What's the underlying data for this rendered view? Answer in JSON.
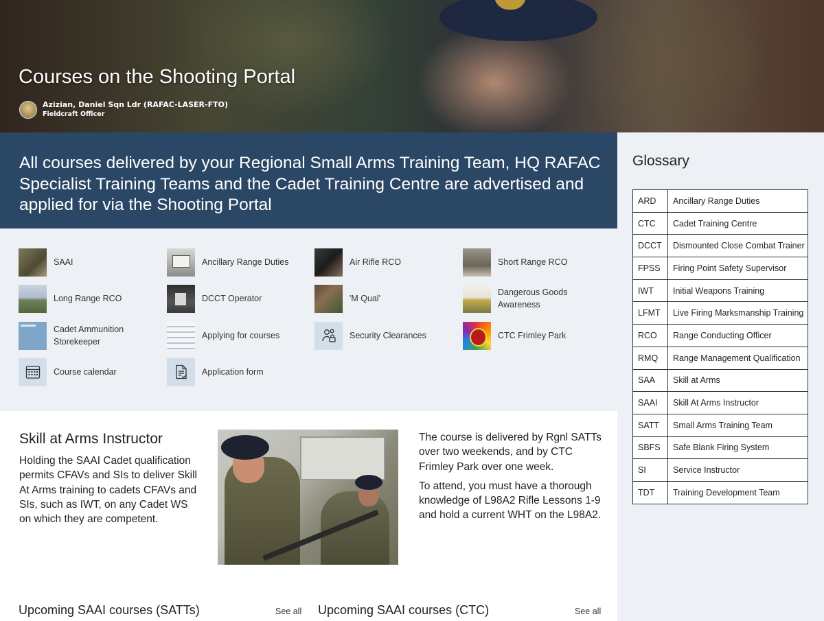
{
  "hero": {
    "title": "Courses on the Shooting Portal",
    "author_name": "Azizian, Daniel Sqn Ldr (RAFAC-LASER-FTO)",
    "author_role": "Fieldcraft Officer"
  },
  "banner": {
    "text": "All courses delivered by your Regional Small Arms Training Team, HQ RAFAC Specialist Training Teams and the Cadet Training Centre are advertised and applied for via the Shooting Portal"
  },
  "quick_links": [
    {
      "label": "SAAI",
      "icon": "saai-thumbnail"
    },
    {
      "label": "Ancillary Range Duties",
      "icon": "ancillary-range-duties-thumbnail"
    },
    {
      "label": "Air Rifle RCO",
      "icon": "air-rifle-rco-thumbnail"
    },
    {
      "label": "Short Range RCO",
      "icon": "short-range-rco-thumbnail"
    },
    {
      "label": "Long Range RCO",
      "icon": "long-range-rco-thumbnail"
    },
    {
      "label": "DCCT Operator",
      "icon": "dcct-operator-thumbnail"
    },
    {
      "label": "'M Qual'",
      "icon": "m-qual-thumbnail"
    },
    {
      "label": "Dangerous Goods Awareness",
      "icon": "dangerous-goods-thumbnail"
    },
    {
      "label": "Cadet Ammunition Storekeeper",
      "icon": "ammunition-storekeeper-thumbnail"
    },
    {
      "label": "Applying for courses",
      "icon": "applying-thumbnail"
    },
    {
      "label": "Security Clearances",
      "icon": "people-lock-icon"
    },
    {
      "label": "CTC Frimley Park",
      "icon": "ctc-crest-thumbnail"
    },
    {
      "label": "Course calendar",
      "icon": "calendar-icon"
    },
    {
      "label": "Application form",
      "icon": "document-check-icon"
    }
  ],
  "glossary": {
    "title": "Glossary",
    "rows": [
      {
        "abbr": "ARD",
        "full": "Ancillary Range Duties"
      },
      {
        "abbr": "CTC",
        "full": "Cadet Training Centre"
      },
      {
        "abbr": "DCCT",
        "full": "Dismounted Close Combat Trainer"
      },
      {
        "abbr": "FPSS",
        "full": "Firing Point Safety Supervisor"
      },
      {
        "abbr": "IWT",
        "full": "Initial Weapons Training"
      },
      {
        "abbr": "LFMT",
        "full": "Live Firing Marksmanship Training"
      },
      {
        "abbr": "RCO",
        "full": "Range Conducting Officer"
      },
      {
        "abbr": "RMQ",
        "full": "Range Management Qualification"
      },
      {
        "abbr": "SAA",
        "full": "Skill at Arms"
      },
      {
        "abbr": "SAAI",
        "full": "Skill At Arms Instructor"
      },
      {
        "abbr": "SATT",
        "full": "Small Arms Training Team"
      },
      {
        "abbr": "SBFS",
        "full": "Safe Blank Firing System"
      },
      {
        "abbr": "SI",
        "full": "Service Instructor"
      },
      {
        "abbr": "TDT",
        "full": "Training Development Team"
      }
    ]
  },
  "saai": {
    "title": "Skill at Arms Instructor",
    "description": "Holding the SAAI Cadet qualification permits CFAVs and SIs to deliver Skill At Arms training to cadets CFAVs and SIs, such as IWT, on any Cadet WS on which they are competent.",
    "info_1": "The course is delivered by Rgnl SATTs over two weekends, and by CTC Frimley Park over one week.",
    "info_2": "To attend, you must have a thorough knowledge of L98A2 Rifle Lessons 1-9 and hold a current WHT on the L98A2."
  },
  "upcoming": {
    "satt_title": "Upcoming SAAI courses (SATTs)",
    "ctc_title": "Upcoming SAAI courses (CTC)",
    "see_all": "See all"
  },
  "colors": {
    "banner_bg": "#2b4766",
    "panel_bg": "#edf1f6"
  }
}
